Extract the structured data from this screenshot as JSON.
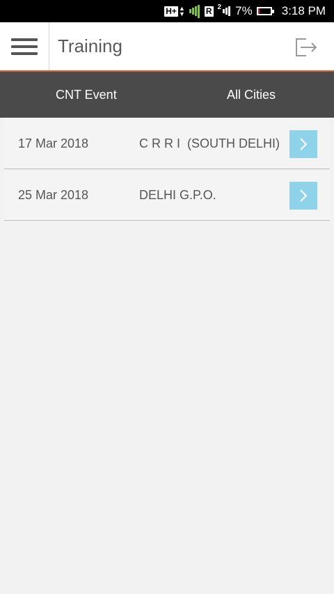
{
  "status_bar": {
    "network": "H+",
    "roaming_badge": "R",
    "sim_number": "2",
    "battery_percent_text": "7%",
    "battery_level": 0.07,
    "time": "3:18 PM"
  },
  "app_bar": {
    "title": "Training",
    "menu_icon": "hamburger-menu-icon",
    "logout_icon": "logout-icon"
  },
  "filters": {
    "event_label": "CNT Event",
    "city_label": "All Cities"
  },
  "events": [
    {
      "date": "17 Mar 2018",
      "location": "C R R I  (SOUTH DELHI)"
    },
    {
      "date": "25 Mar 2018",
      "location": "DELHI G.P.O."
    }
  ],
  "colors": {
    "accent_line": "#d9632a",
    "filter_bar": "#4a4a4a",
    "arrow_button": "#8fd3ea"
  }
}
